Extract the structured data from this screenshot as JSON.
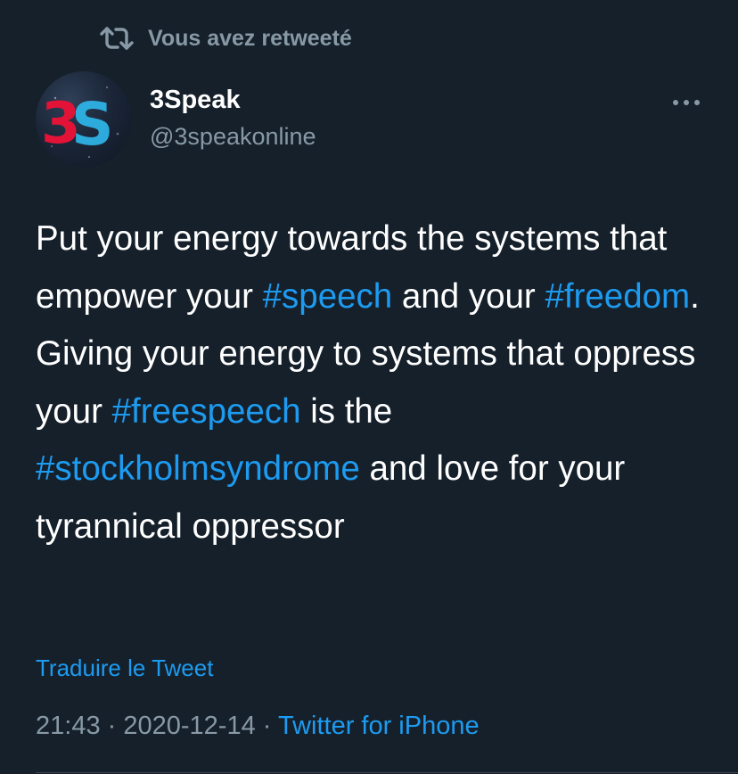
{
  "retweet_banner": {
    "icon": "retweet-icon",
    "label": "Vous avez retweeté"
  },
  "author": {
    "avatar_text": "3S",
    "display_name": "3Speak",
    "handle": "@3speakonline"
  },
  "more_menu": {
    "icon": "more-horizontal-icon"
  },
  "tweet": {
    "segments": [
      {
        "text": "Put your energy towards the systems that empower your ",
        "hashtag": false
      },
      {
        "text": "#speech",
        "hashtag": true
      },
      {
        "text": " and your ",
        "hashtag": false
      },
      {
        "text": "#freedom",
        "hashtag": true
      },
      {
        "text": ". Giving your energy to systems that oppress your ",
        "hashtag": false
      },
      {
        "text": "#freespeech",
        "hashtag": true
      },
      {
        "text": " is the ",
        "hashtag": false
      },
      {
        "text": "#stockholmsyndrome",
        "hashtag": true
      },
      {
        "text": " and love for your tyrannical oppressor",
        "hashtag": false
      }
    ]
  },
  "translate_label": "Traduire le Tweet",
  "meta": {
    "time": "21:43",
    "separator": " · ",
    "date": "2020-12-14",
    "source": "Twitter for iPhone"
  },
  "colors": {
    "background": "#15202b",
    "link": "#1d9bf0",
    "secondary_text": "#8899a6",
    "logo_red": "#e31337",
    "logo_blue": "#2fb7ea"
  }
}
